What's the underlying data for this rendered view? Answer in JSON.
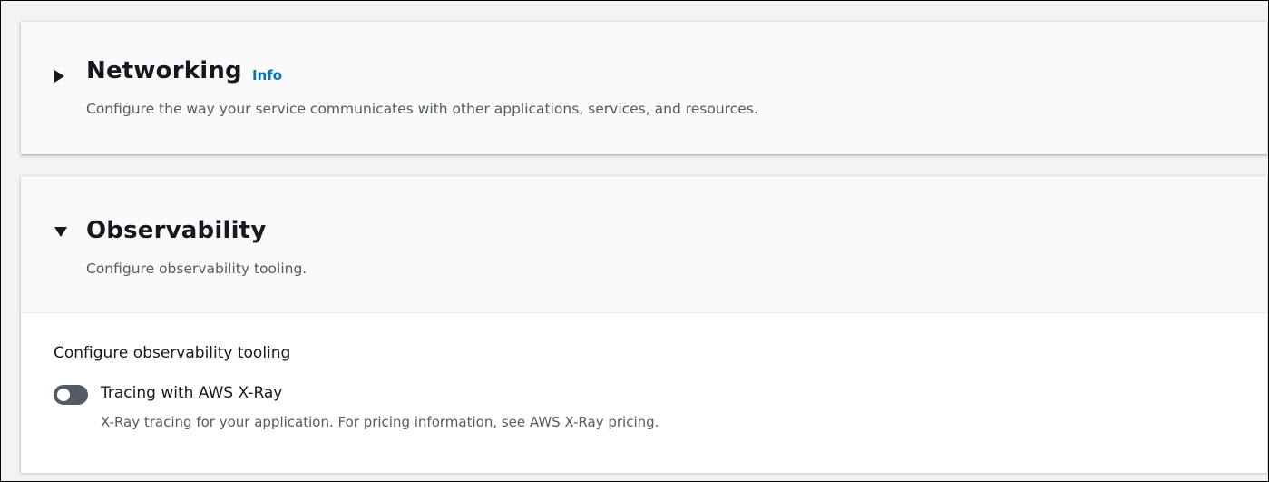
{
  "networking": {
    "title": "Networking",
    "info_link": "Info",
    "description": "Configure the way your service communicates with other applications, services, and resources.",
    "expanded": false
  },
  "observability": {
    "title": "Observability",
    "description": "Configure observability tooling.",
    "expanded": true,
    "section_label": "Configure observability tooling",
    "tracing": {
      "label": "Tracing with AWS X-Ray",
      "description": "X-Ray tracing for your application. For pricing information, see AWS X-Ray pricing.",
      "enabled": false
    }
  },
  "colors": {
    "link": "#0073bb",
    "text": "#16191f",
    "secondary_text": "#545b64",
    "toggle_off": "#545b64",
    "page_background": "#f2f3f3"
  }
}
